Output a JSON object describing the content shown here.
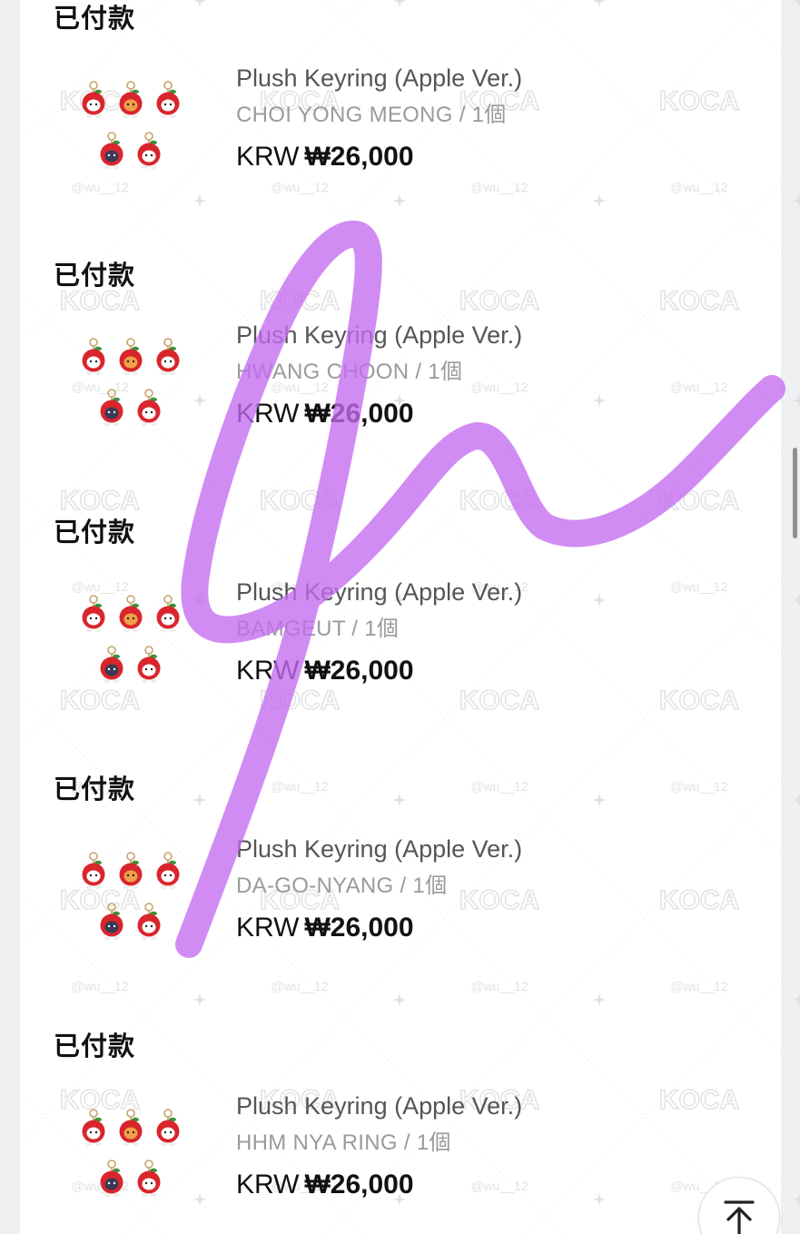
{
  "orders": [
    {
      "status": "已付款",
      "product_name": "Plush Keyring (Apple Ver.)",
      "option": "CHOI YONG MEONG / 1個",
      "currency": "KRW",
      "amount": "₩26,000"
    },
    {
      "status": "已付款",
      "product_name": "Plush Keyring (Apple Ver.)",
      "option": "HWANG CHOON / 1個",
      "currency": "KRW",
      "amount": "₩26,000"
    },
    {
      "status": "已付款",
      "product_name": "Plush Keyring (Apple Ver.)",
      "option": "BAMGEUT / 1個",
      "currency": "KRW",
      "amount": "₩26,000"
    },
    {
      "status": "已付款",
      "product_name": "Plush Keyring (Apple Ver.)",
      "option": "DA-GO-NYANG / 1個",
      "currency": "KRW",
      "amount": "₩26,000"
    },
    {
      "status": "已付款",
      "product_name": "Plush Keyring (Apple Ver.)",
      "option": "HHM NYA RING / 1個",
      "currency": "KRW",
      "amount": "₩26,000"
    }
  ],
  "watermark": {
    "logo_text": "KOCA",
    "handle_text": "@wu__12"
  },
  "icons": {
    "scroll_top": "arrow-up-to-top-icon",
    "product_thumbnail": "apple-plush-keyrings-image"
  },
  "colors": {
    "status_text": "#111111",
    "product_name": "#555555",
    "option_text": "#9a9a9a",
    "price_text": "#111111",
    "scribble": "#c46cf0",
    "apple_red": "#d8262c"
  }
}
